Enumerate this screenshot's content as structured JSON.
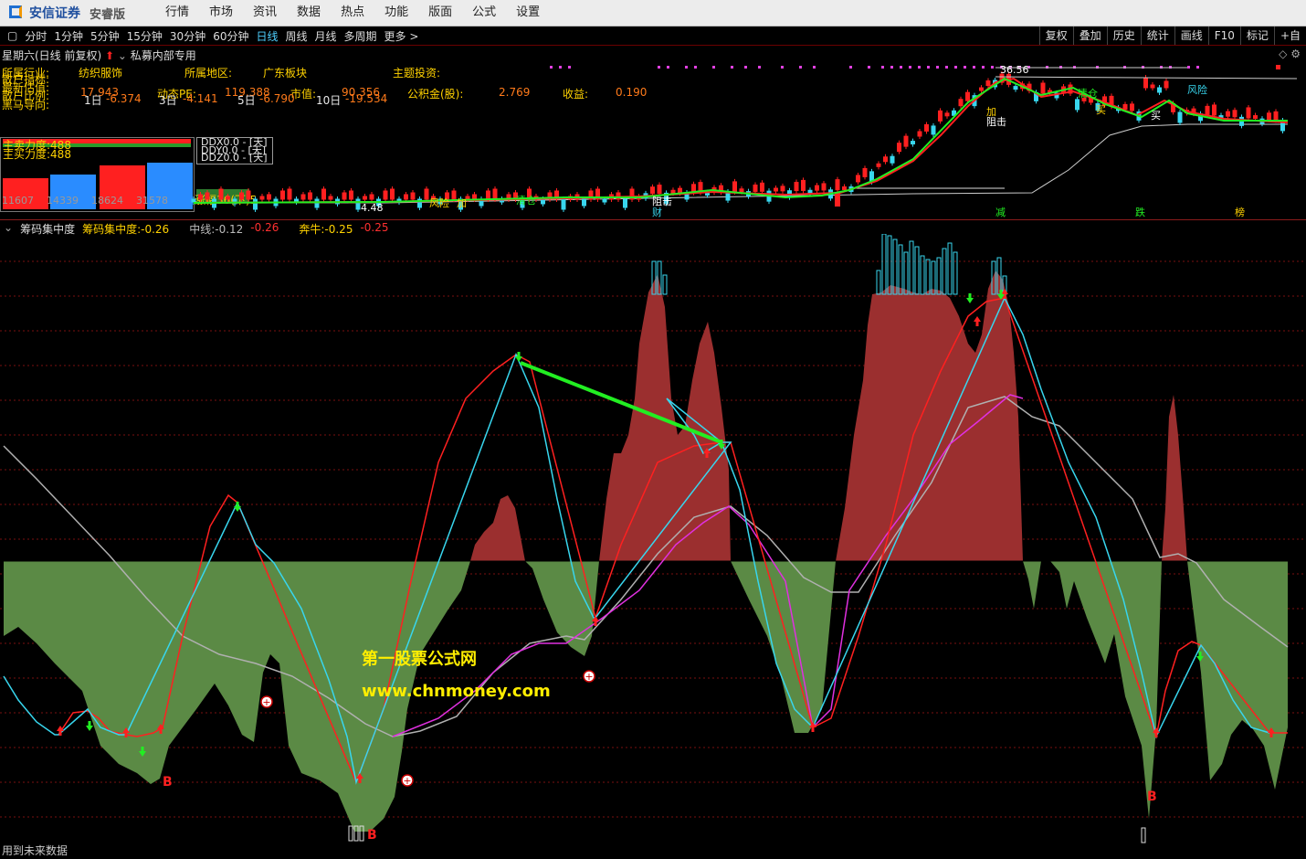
{
  "app": {
    "logo_text": "安信证券",
    "edition": "安睿版",
    "menu": [
      "行情",
      "市场",
      "资讯",
      "数据",
      "热点",
      "功能",
      "版面",
      "公式",
      "设置"
    ]
  },
  "toolbar": {
    "periods": [
      "分时",
      "1分钟",
      "5分钟",
      "15分钟",
      "30分钟",
      "60分钟",
      "日线",
      "周线",
      "月线",
      "多周期",
      "更多 >"
    ],
    "active_period": "日线",
    "right_buttons": [
      "复权",
      "叠加",
      "历史",
      "统计",
      "画线",
      "F10",
      "标记",
      "+自"
    ]
  },
  "kline_header": {
    "title": "星期六(日线 前复权)",
    "formula": "私募内部专用"
  },
  "stock_info": {
    "row1": [
      {
        "label": "所属行业:",
        "value": "纺织服饰"
      },
      {
        "label": "所属地区:",
        "value": "广东板块"
      },
      {
        "label": "主题投资:",
        "value": ""
      }
    ],
    "row2": [
      {
        "label": "动态PE:",
        "value": "119.388"
      },
      {
        "label": "市值:",
        "value": "90.356"
      },
      {
        "label": "公积金(股):",
        "value": "2.769"
      },
      {
        "label": "收益:",
        "value": "0.190"
      }
    ],
    "row2_first_value": "17.943",
    "row3": [
      {
        "label": "1日",
        "value": "-6.374"
      },
      {
        "label": "3日",
        "value": "-4.141"
      },
      {
        "label": "5日",
        "value": "-6.790"
      },
      {
        "label": "10日",
        "value": "-19.534"
      }
    ],
    "row3_label": "黑马导向:",
    "stacked_labels": [
      "散户指标:",
      "最新估值:",
      "散户比例:"
    ],
    "max_price": "36.56",
    "min_price": "4.48",
    "volume_values": [
      "11607",
      "14339",
      "18624",
      "31578"
    ],
    "force_labels": [
      "主卖力度:488",
      "主买力度:488"
    ],
    "ddx": [
      "DDX0.0 - [天]",
      "DDY0.0 - [天]",
      "DDZ0.0 - [天]"
    ],
    "spread_label": "涨幅36(下)5"
  },
  "kline_markers": [
    "加",
    "风险",
    "清仓",
    "阻击",
    "买",
    "财",
    "减",
    "跌",
    "榜",
    "加",
    "风险",
    "清仓",
    "阻击",
    "买"
  ],
  "indicator": {
    "name": "筹码集中度",
    "items": [
      {
        "label": "筹码集中度:",
        "value": "-0.26",
        "color": "#ffd200"
      },
      {
        "label": "中线:",
        "value": "-0.12",
        "color": "#bbbbbb"
      },
      {
        "label": "",
        "value": "-0.26",
        "color": "#ff3030"
      },
      {
        "label": "奔牛:",
        "value": "-0.25",
        "color": "#ffd200"
      },
      {
        "label": "",
        "value": "-0.25",
        "color": "#ff3030"
      }
    ],
    "signals": [
      "B",
      "B",
      "B"
    ],
    "watermark_line1": "第一股票公式网",
    "watermark_line2": "www.chnmoney.com"
  },
  "footer": {
    "note": "用到未来数据"
  },
  "colors": {
    "red_area": "#9b2f2f",
    "green_area": "#5b8a45",
    "cyan_line": "#38d6ee",
    "red_line": "#ff2020",
    "magenta_line": "#e030e0",
    "gray_line": "#b0b0b0"
  }
}
